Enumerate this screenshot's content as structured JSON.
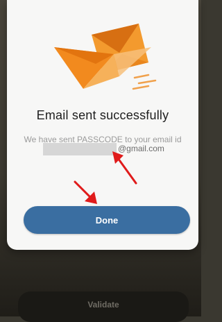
{
  "dialog": {
    "title": "Email sent successfully",
    "message": "We have sent PASSCODE to your email id",
    "email_domain": "@gmail.com",
    "done_label": "Done",
    "icon": "paper-plane-envelope-icon"
  },
  "background": {
    "validate_label": "Validate"
  },
  "colors": {
    "primary_button": "#3a6ea1",
    "annotation_arrow": "#e01b1b",
    "envelope_orange": "#f08a1f"
  }
}
